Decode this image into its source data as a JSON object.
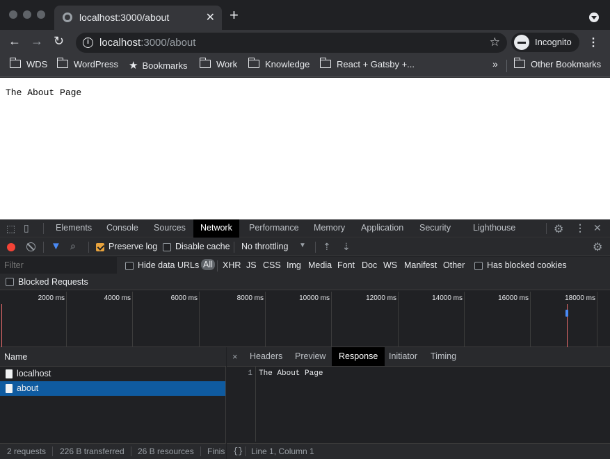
{
  "browser": {
    "tab_title": "localhost:3000/about",
    "url_host": "localhost",
    "url_rest": ":3000/about",
    "profile_label": "Incognito"
  },
  "bookmarks": {
    "items": [
      "WDS",
      "WordPress",
      "Bookmarks",
      "Work",
      "Knowledge",
      "React + Gatsby +..."
    ],
    "overflow_icon": "»",
    "other": "Other Bookmarks"
  },
  "page": {
    "text": "The About Page"
  },
  "devtools": {
    "tabs": [
      "Elements",
      "Console",
      "Sources",
      "Network",
      "Performance",
      "Memory",
      "Application",
      "Security",
      "Lighthouse"
    ],
    "active_tab": "Network",
    "toolbar": {
      "preserve_log": "Preserve log",
      "disable_cache": "Disable cache",
      "throttling": "No throttling"
    },
    "filter": {
      "placeholder": "Filter",
      "hide_data_urls": "Hide data URLs",
      "types": [
        "All",
        "XHR",
        "JS",
        "CSS",
        "Img",
        "Media",
        "Font",
        "Doc",
        "WS",
        "Manifest",
        "Other"
      ],
      "has_blocked_cookies": "Has blocked cookies",
      "blocked_requests": "Blocked Requests"
    },
    "overview": {
      "labels": [
        "2000 ms",
        "4000 ms",
        "6000 ms",
        "8000 ms",
        "10000 ms",
        "12000 ms",
        "14000 ms",
        "16000 ms",
        "18000 ms"
      ]
    },
    "requests": {
      "header": "Name",
      "rows": [
        "localhost",
        "about"
      ],
      "selected": "about"
    },
    "status": {
      "requests": "2 requests",
      "transferred": "226 B transferred",
      "resources": "26 B resources",
      "finish": "Finis"
    },
    "detail": {
      "close": "×",
      "tabs": [
        "Headers",
        "Preview",
        "Response",
        "Initiator",
        "Timing"
      ],
      "active_tab": "Response",
      "line_number": "1",
      "response_text": "The About Page",
      "format_icon": "{}",
      "position": "Line 1, Column 1"
    }
  },
  "colors": {
    "record": "#f44336",
    "checkbox_on": "#e8a33d",
    "selection": "#0f5ba0"
  }
}
